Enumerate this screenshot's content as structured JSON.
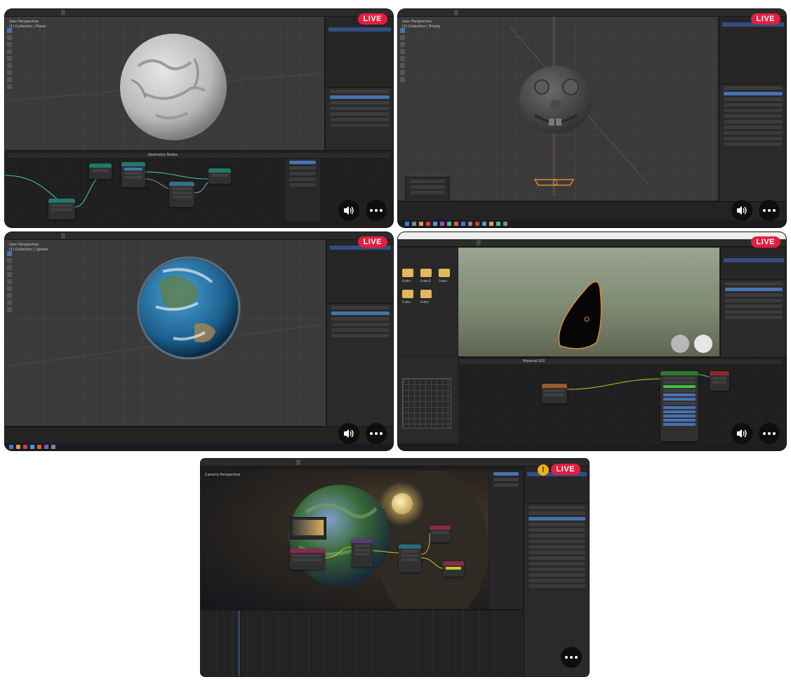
{
  "badges": {
    "live": "LIVE"
  },
  "tile_1": {
    "viewport_label": "User Perspective\n(1) Collection | Plane",
    "node_header": "Geometry Nodes"
  },
  "tile_2": {
    "viewport_label": "User Perspective\n(1) Collection | Empty"
  },
  "tile_3": {
    "viewport_label": "User Perspective\n(1) Collection | Sphere"
  },
  "tile_4": {
    "folders": [
      "Folder",
      "Folder2",
      "Folder",
      "Folder",
      "Folder"
    ],
    "node_header": "Material.002"
  },
  "tile_5": {
    "viewport_label": "Camera Perspective"
  },
  "icons": {
    "speaker": "speaker-volume-icon",
    "more": "more-options-icon",
    "warning": "warning-icon"
  },
  "colors": {
    "live_red": "#e41e3f",
    "blender_bg": "#3d3d3d",
    "selection_blue": "#4772b3",
    "warning_yellow": "#f2b10b"
  }
}
